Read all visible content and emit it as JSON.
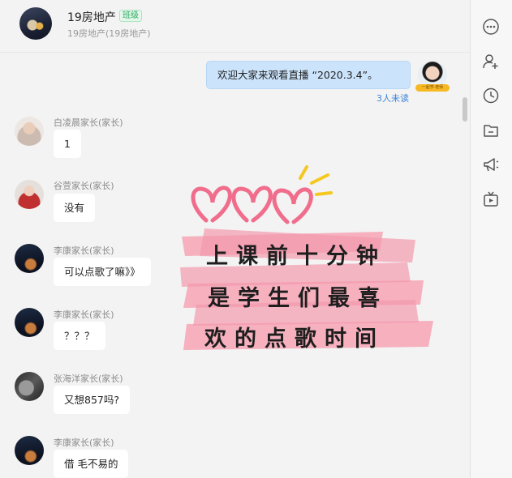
{
  "header": {
    "group_name": "19房地产",
    "badge": "班级",
    "subtitle": "19房地产(19房地产)"
  },
  "sent_message": {
    "text": "欢迎大家来观看直播 “2020.3.4”。",
    "unread": "3人未读",
    "avatar_tag": "一起学·老师"
  },
  "messages": [
    {
      "sender": "白凌晨家长(家长)",
      "text": "1"
    },
    {
      "sender": "谷萱家长(家长)",
      "text": "没有"
    },
    {
      "sender": "李康家长(家长)",
      "text": "可以点歌了嘛》》"
    },
    {
      "sender": "李康家长(家长)",
      "text": "？？？"
    },
    {
      "sender": "张海洋家长(家长)",
      "text": "又想857吗?"
    },
    {
      "sender": "李康家长(家长)",
      "text": "借  毛不易的"
    }
  ],
  "sticker": {
    "lines": [
      "上课前十分钟",
      "是学生们最喜",
      "欢的点歌时间"
    ]
  },
  "sidebar": {
    "icons": [
      "more-icon",
      "add-member-icon",
      "history-icon",
      "folder-icon",
      "announcement-icon",
      "live-tv-icon"
    ]
  },
  "colors": {
    "sent_bubble": "#cce4fb",
    "unread_text": "#3a86d8",
    "badge_green": "#2dab62",
    "sticker_pink": "#f06d8c"
  }
}
